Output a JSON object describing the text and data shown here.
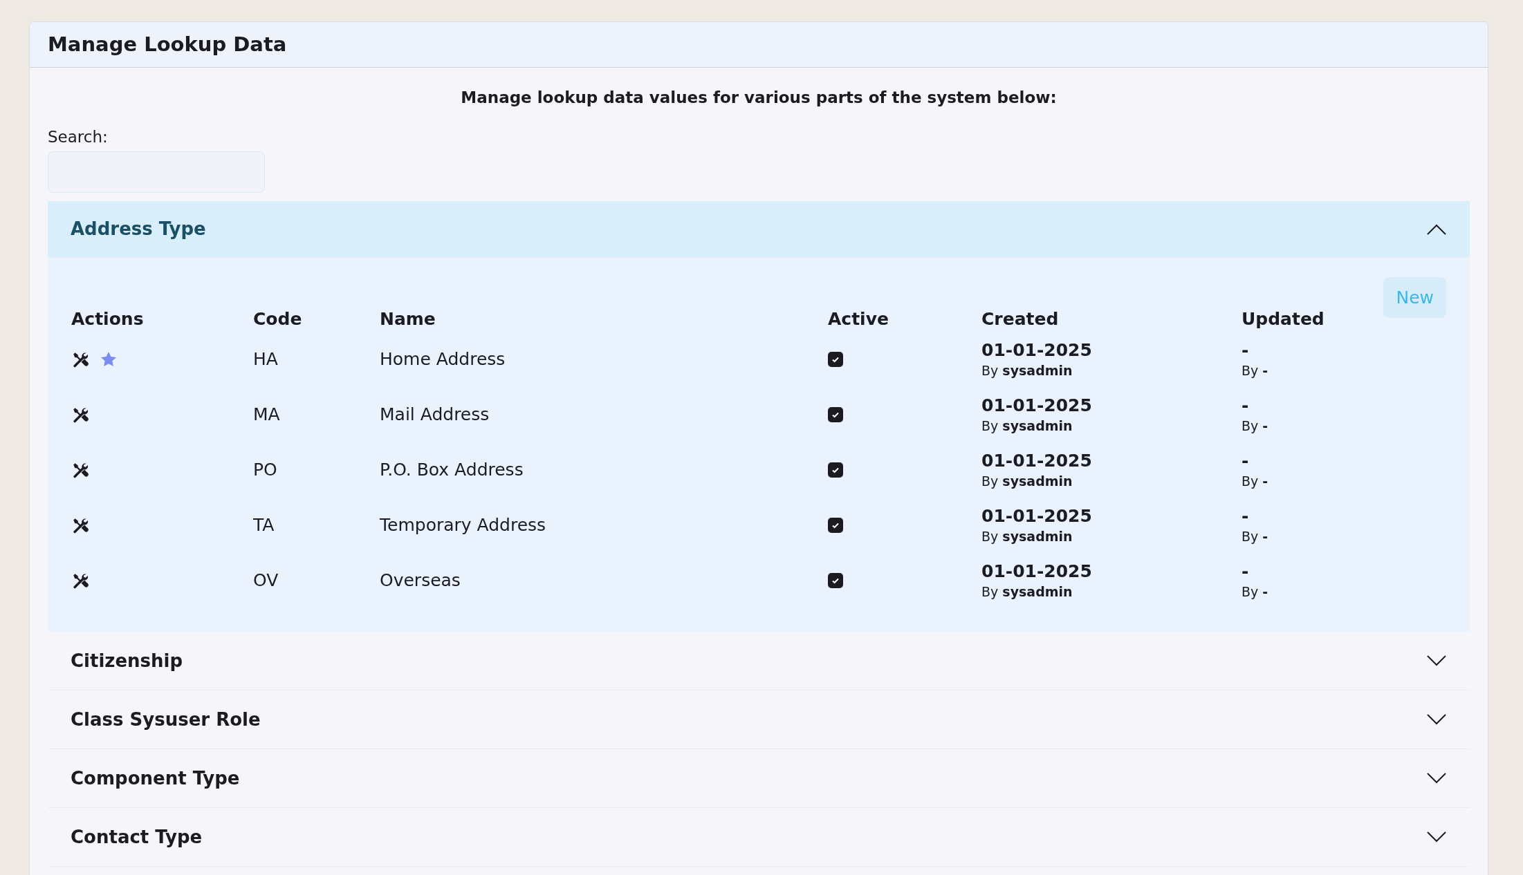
{
  "card": {
    "title": "Manage Lookup Data"
  },
  "intro": "Manage lookup data values for various parts of the system below:",
  "search": {
    "label": "Search:"
  },
  "sections": [
    {
      "title": "Address Type",
      "expanded": true,
      "new_button": "New",
      "columns": [
        "Actions",
        "Code",
        "Name",
        "Active",
        "Created",
        "Updated"
      ],
      "rows": [
        {
          "starred": true,
          "code": "HA",
          "name": "Home Address",
          "active": true,
          "created": "01-01-2025",
          "created_by": "By **sysadmin**",
          "updated": "-",
          "updated_by": "By **-**"
        },
        {
          "starred": false,
          "code": "MA",
          "name": "Mail Address",
          "active": true,
          "created": "01-01-2025",
          "created_by": "By **sysadmin**",
          "updated": "-",
          "updated_by": "By **-**"
        },
        {
          "starred": false,
          "code": "PO",
          "name": "P.O. Box Address",
          "active": true,
          "created": "01-01-2025",
          "created_by": "By **sysadmin**",
          "updated": "-",
          "updated_by": "By **-**"
        },
        {
          "starred": false,
          "code": "TA",
          "name": "Temporary Address",
          "active": true,
          "created": "01-01-2025",
          "created_by": "By **sysadmin**",
          "updated": "-",
          "updated_by": "By **-**"
        },
        {
          "starred": false,
          "code": "OV",
          "name": "Overseas",
          "active": true,
          "created": "01-01-2025",
          "created_by": "By **sysadmin**",
          "updated": "-",
          "updated_by": "By **-**"
        }
      ]
    },
    {
      "title": "Citizenship",
      "expanded": false
    },
    {
      "title": "Class Sysuser Role",
      "expanded": false
    },
    {
      "title": "Component Type",
      "expanded": false
    },
    {
      "title": "Contact Type",
      "expanded": false
    }
  ]
}
